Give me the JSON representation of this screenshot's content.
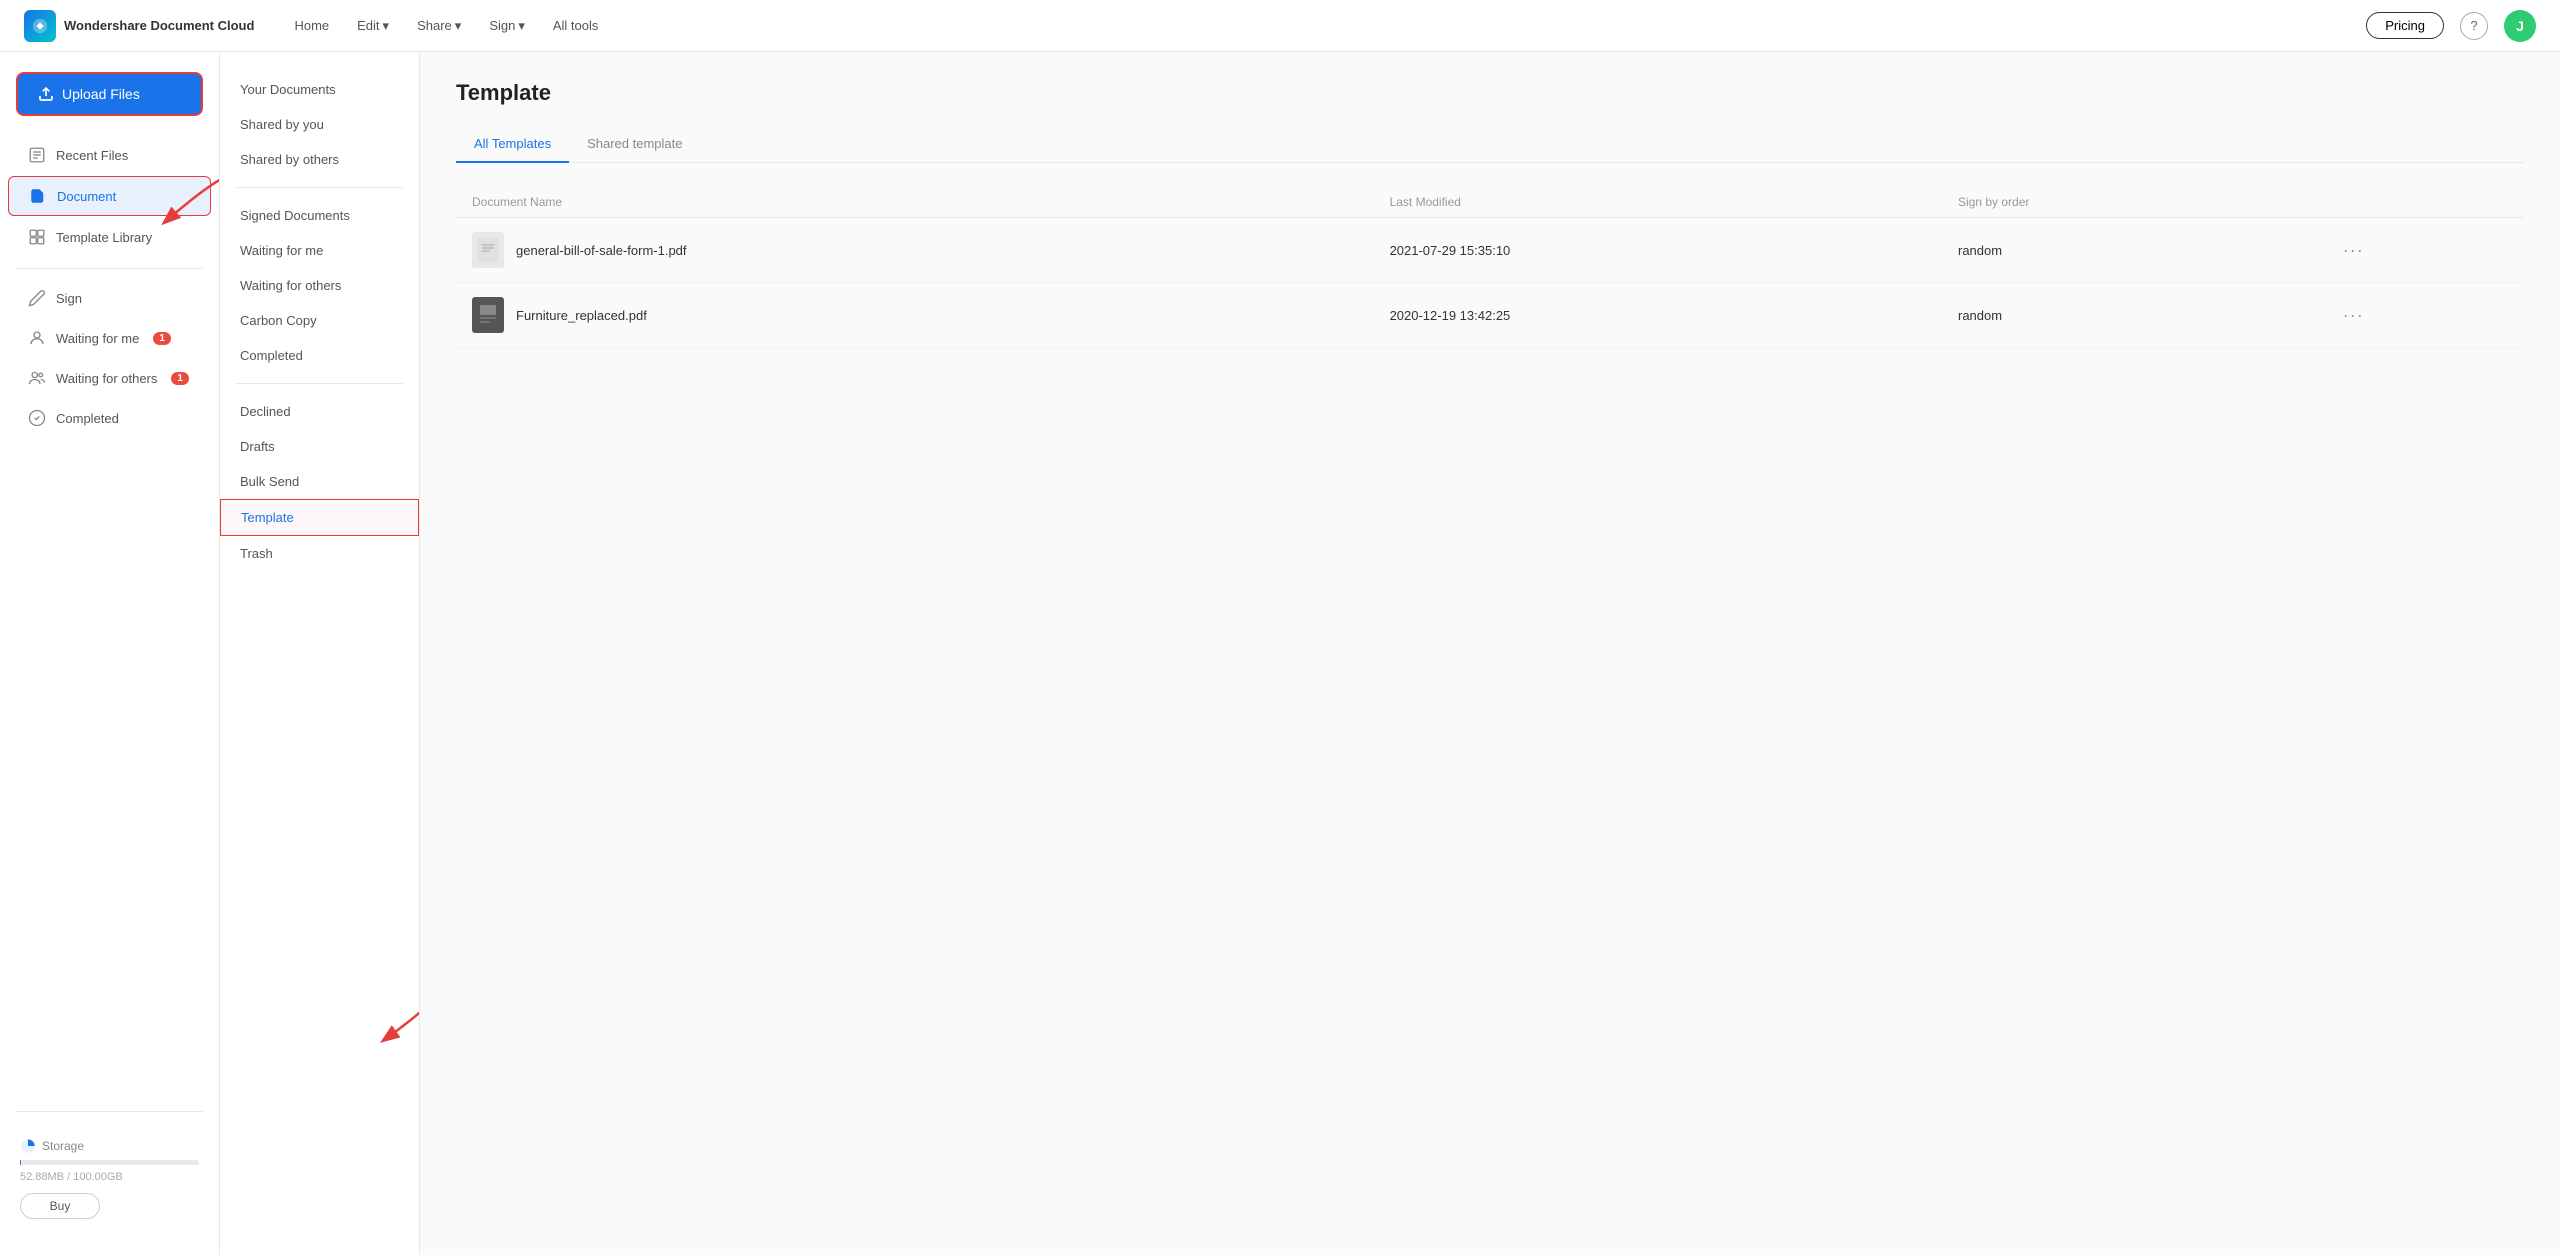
{
  "app": {
    "name": "Wondershare Document Cloud"
  },
  "topnav": {
    "home_label": "Home",
    "edit_label": "Edit",
    "share_label": "Share",
    "sign_label": "Sign",
    "all_tools_label": "All tools",
    "pricing_label": "Pricing",
    "help_icon": "?",
    "avatar_initial": "J"
  },
  "left_sidebar": {
    "upload_label": "Upload Files",
    "items": [
      {
        "id": "recent-files",
        "label": "Recent Files",
        "icon": "recent"
      },
      {
        "id": "document",
        "label": "Document",
        "icon": "document",
        "active": true
      },
      {
        "id": "template-library",
        "label": "Template Library",
        "icon": "template"
      }
    ],
    "sign_section": {
      "label": "Sign",
      "items": [
        {
          "id": "waiting-for-me",
          "label": "Waiting for me",
          "badge": "1"
        },
        {
          "id": "waiting-for-others",
          "label": "Waiting for others",
          "badge": "1"
        },
        {
          "id": "completed",
          "label": "Completed"
        }
      ]
    },
    "storage": {
      "label": "Storage",
      "used": "52.88MB",
      "total": "100.00GB",
      "percent": 0.05,
      "buy_label": "Buy"
    }
  },
  "mid_sidebar": {
    "items": [
      {
        "id": "your-documents",
        "label": "Your Documents"
      },
      {
        "id": "shared-by-you",
        "label": "Shared by you"
      },
      {
        "id": "shared-by-others",
        "label": "Shared by others"
      }
    ],
    "sign_items": [
      {
        "id": "signed-documents",
        "label": "Signed Documents"
      },
      {
        "id": "waiting-for-me",
        "label": "Waiting for me"
      },
      {
        "id": "waiting-for-others",
        "label": "Waiting for others"
      },
      {
        "id": "carbon-copy",
        "label": "Carbon Copy"
      },
      {
        "id": "completed",
        "label": "Completed"
      }
    ],
    "more_items": [
      {
        "id": "declined",
        "label": "Declined"
      },
      {
        "id": "drafts",
        "label": "Drafts"
      },
      {
        "id": "bulk-send",
        "label": "Bulk Send"
      },
      {
        "id": "template",
        "label": "Template",
        "active": true
      },
      {
        "id": "trash",
        "label": "Trash"
      }
    ]
  },
  "main": {
    "page_title": "Template",
    "tabs": [
      {
        "id": "all-templates",
        "label": "All Templates",
        "active": true
      },
      {
        "id": "shared-template",
        "label": "Shared template"
      }
    ],
    "table": {
      "columns": [
        {
          "id": "doc-name",
          "label": "Document Name"
        },
        {
          "id": "last-modified",
          "label": "Last Modified"
        },
        {
          "id": "sign-by-order",
          "label": "Sign by order"
        }
      ],
      "rows": [
        {
          "id": "row-1",
          "name": "general-bill-of-sale-form-1.pdf",
          "last_modified": "2021-07-29 15:35:10",
          "sign_by_order": "random",
          "thumb_color": "#d0d0d0"
        },
        {
          "id": "row-2",
          "name": "Furniture_replaced.pdf",
          "last_modified": "2020-12-19 13:42:25",
          "sign_by_order": "random",
          "thumb_color": "#444"
        }
      ]
    }
  }
}
